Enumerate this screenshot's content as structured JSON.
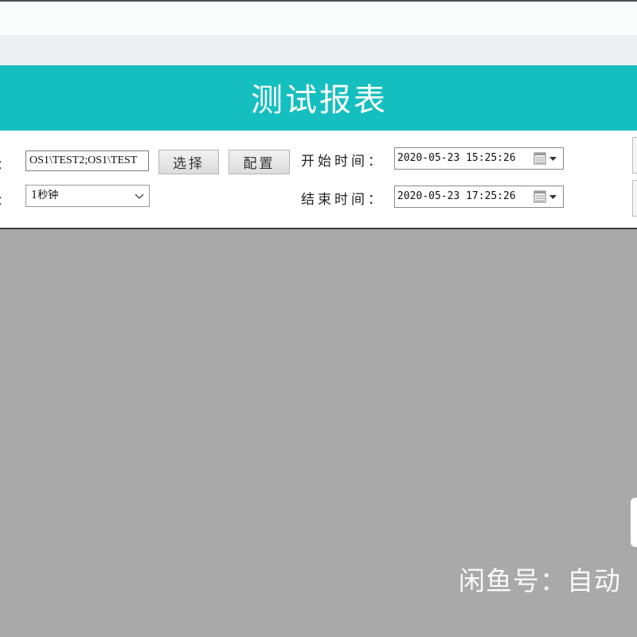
{
  "report": {
    "title": "测试报表"
  },
  "filters": {
    "path_colon": "：",
    "path_value": "OS1\\TEST2;OS1\\TEST",
    "select_button": "选择",
    "config_button": "配置",
    "interval_colon": "：",
    "interval_selected": "1秒钟",
    "start_label": "开始时间：",
    "start_value": "2020-05-23 15:25:26",
    "end_label": "结束时间：",
    "end_value": "2020-05-23 17:25:26"
  },
  "overlay": {
    "watermark": "闲鱼号：自动"
  },
  "icons": {
    "chevron": "chevron-down-icon",
    "calendar": "calendar-icon"
  },
  "colors": {
    "banner": "#16bfbf",
    "body_gray": "#a9a9a9",
    "form_bg": "#ffffff"
  }
}
